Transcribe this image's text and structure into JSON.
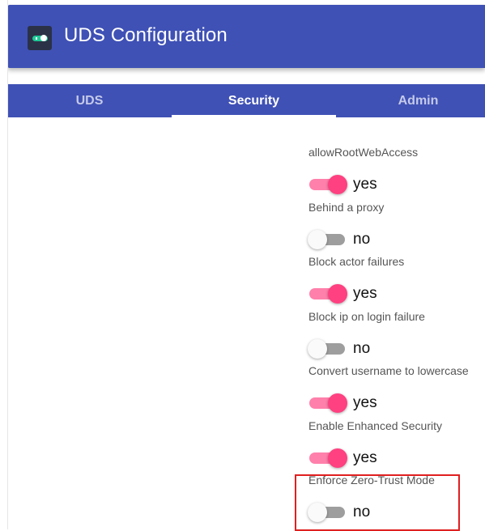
{
  "app": {
    "title": "UDS Configuration"
  },
  "tabs": [
    {
      "label": "UDS",
      "active": false
    },
    {
      "label": "Security",
      "active": true
    },
    {
      "label": "Admin",
      "active": false
    }
  ],
  "settings": [
    {
      "label": "allowRootWebAccess",
      "value": "yes",
      "enabled": true
    },
    {
      "label": "Behind a proxy",
      "value": "no",
      "enabled": false
    },
    {
      "label": "Block actor failures",
      "value": "yes",
      "enabled": true
    },
    {
      "label": "Block ip on login failure",
      "value": "no",
      "enabled": false
    },
    {
      "label": "Convert username to lowercase",
      "value": "yes",
      "enabled": true
    },
    {
      "label": "Enable Enhanced Security",
      "value": "yes",
      "enabled": true
    },
    {
      "label": "Enforce Zero-Trust Mode",
      "value": "no",
      "enabled": false
    }
  ],
  "colors": {
    "primary": "#3f51b5",
    "accent": "#ff4081",
    "accent_track": "#ff80ab",
    "off_track": "#9e9e9e",
    "highlight": "#e02020"
  },
  "icons": {
    "app_logo": "toggle-switch-icon"
  }
}
